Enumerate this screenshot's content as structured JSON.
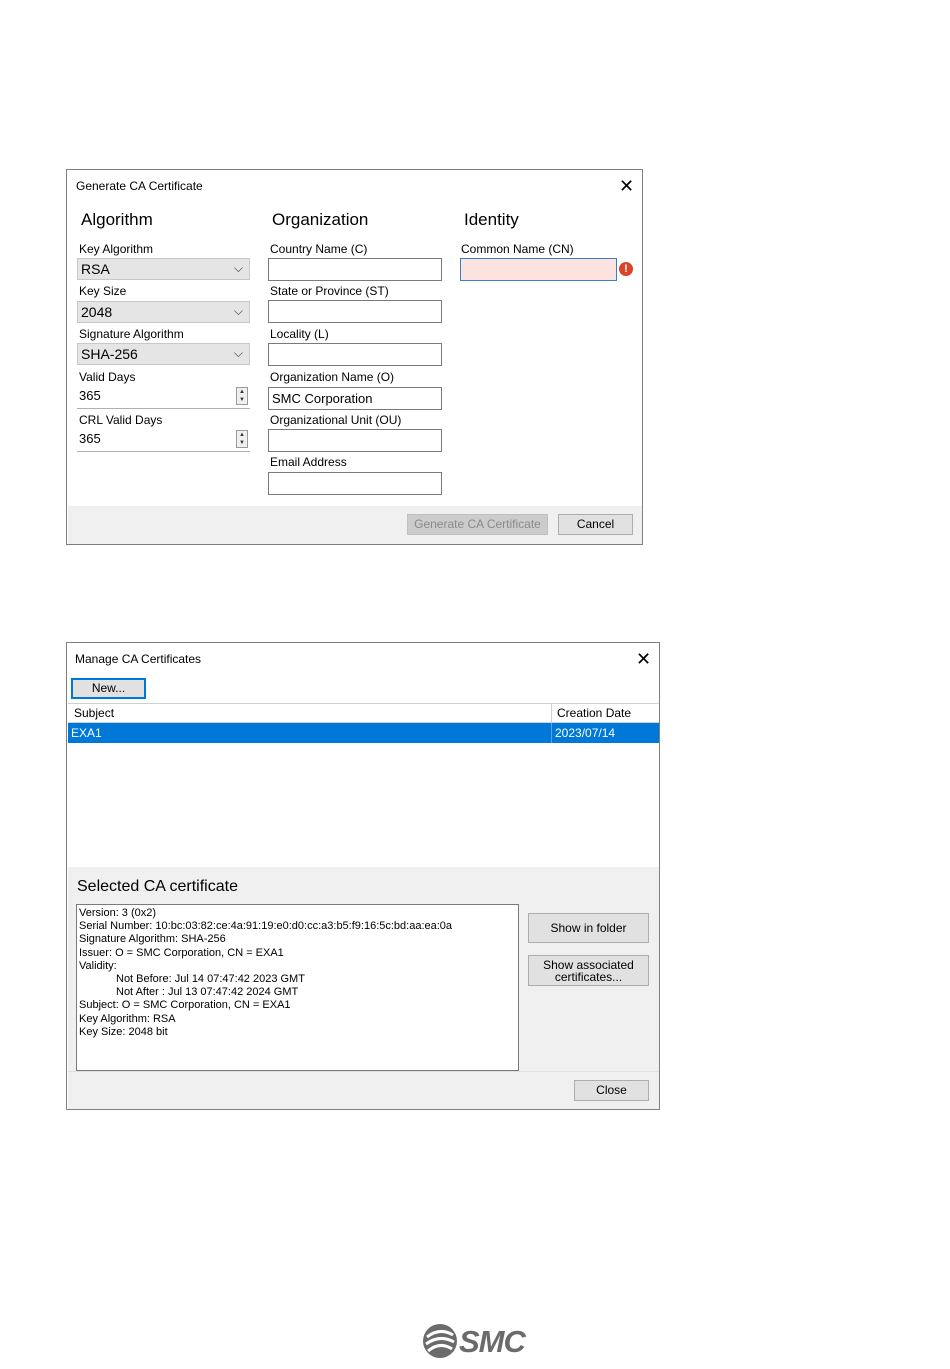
{
  "gen": {
    "title": "Generate CA Certificate",
    "algorithm": {
      "heading": "Algorithm",
      "key_algorithm_label": "Key Algorithm",
      "key_algorithm_value": "RSA",
      "key_size_label": "Key Size",
      "key_size_value": "2048",
      "signature_algorithm_label": "Signature Algorithm",
      "signature_algorithm_value": "SHA-256",
      "valid_days_label": "Valid Days",
      "valid_days_value": "365",
      "crl_valid_days_label": "CRL Valid Days",
      "crl_valid_days_value": "365"
    },
    "organization": {
      "heading": "Organization",
      "country_label": "Country Name (C)",
      "country_value": "",
      "state_label": "State or Province (ST)",
      "state_value": "",
      "locality_label": "Locality (L)",
      "locality_value": "",
      "org_name_label": "Organization Name (O)",
      "org_name_value": "SMC Corporation",
      "org_unit_label": "Organizational Unit (OU)",
      "org_unit_value": "",
      "email_label": "Email Address",
      "email_value": ""
    },
    "identity": {
      "heading": "Identity",
      "common_name_label": "Common Name (CN)",
      "common_name_value": ""
    },
    "generate_button": "Generate CA Certificate",
    "cancel_button": "Cancel"
  },
  "manage": {
    "title": "Manage CA Certificates",
    "new_button": "New...",
    "columns": [
      "Subject",
      "Creation Date"
    ],
    "rows": [
      {
        "subject": "EXA1",
        "date": "2023/07/14"
      }
    ],
    "selected_heading": "Selected CA certificate",
    "details": [
      "Version: 3 (0x2)",
      "Serial Number: 10:bc:03:82:ce:4a:91:19:e0:d0:cc:a3:b5:f9:16:5c:bd:aa:ea:0a",
      "Signature Algorithm: SHA-256",
      "Issuer: O = SMC Corporation, CN = EXA1",
      "Validity:",
      "Not Before: Jul 14 07:47:42 2023 GMT",
      "Not After : Jul 13 07:47:42 2024 GMT",
      "Subject: O = SMC Corporation, CN = EXA1",
      "Key Algorithm: RSA",
      "Key Size: 2048 bit"
    ],
    "show_folder_button": "Show in folder",
    "show_associated_line1": "Show associated",
    "show_associated_line2": "certificates...",
    "close_button": "Close"
  },
  "logo": {
    "text": "SMC"
  },
  "colors": {
    "selection": "#0078d7",
    "error": "#d9442b",
    "error_field_bg": "#fde3e0"
  }
}
